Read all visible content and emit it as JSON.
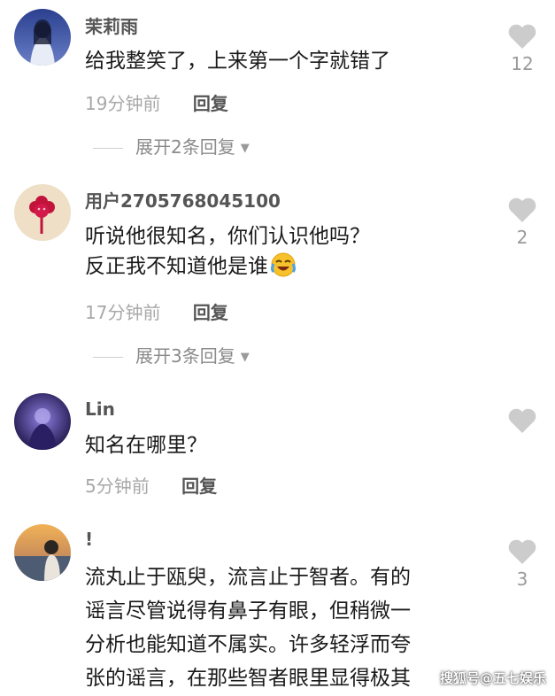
{
  "colors": {
    "username": "#555555",
    "content": "#1a1a1a",
    "time": "#a8a8a8",
    "like_icon": "#cccccc",
    "expand": "#8a8a8a"
  },
  "comments": [
    {
      "username": "茉莉雨",
      "content_lines": [
        "给我整笑了，上来第一个字就错了"
      ],
      "time": "19分钟前",
      "reply_label": "回复",
      "expand_label": "展开2条回复",
      "like_count": "12",
      "avatar_icon": "avatar-photo-icon"
    },
    {
      "username": "用户2705768045100",
      "content_lines": [
        "听说他很知名，你们认识他吗？",
        "反正我不知道他是谁"
      ],
      "emoji": "laughing-crying-emoji-icon",
      "time": "17分钟前",
      "reply_label": "回复",
      "expand_label": "展开3条回复",
      "like_count": "2",
      "avatar_icon": "avatar-flower-icon"
    },
    {
      "username": "Lin",
      "content_lines": [
        "知名在哪里？"
      ],
      "time": "5分钟前",
      "reply_label": "回复",
      "like_count": "",
      "avatar_icon": "avatar-photo-icon"
    },
    {
      "username": "!",
      "content_lines": [
        "流丸止于瓯臾，流言止于智者。有的",
        "谣言尽管说得有鼻子有眼，但稍微一",
        "分析也能知道不属实。许多轻浮而夸",
        "张的谣言，在那些智者眼里显得极其"
      ],
      "like_count": "3",
      "avatar_icon": "avatar-photo-icon"
    }
  ],
  "watermark": "搜狐号@五七娱乐",
  "icons": {
    "like": "heart-icon",
    "expand_caret": "caret-down-icon"
  }
}
